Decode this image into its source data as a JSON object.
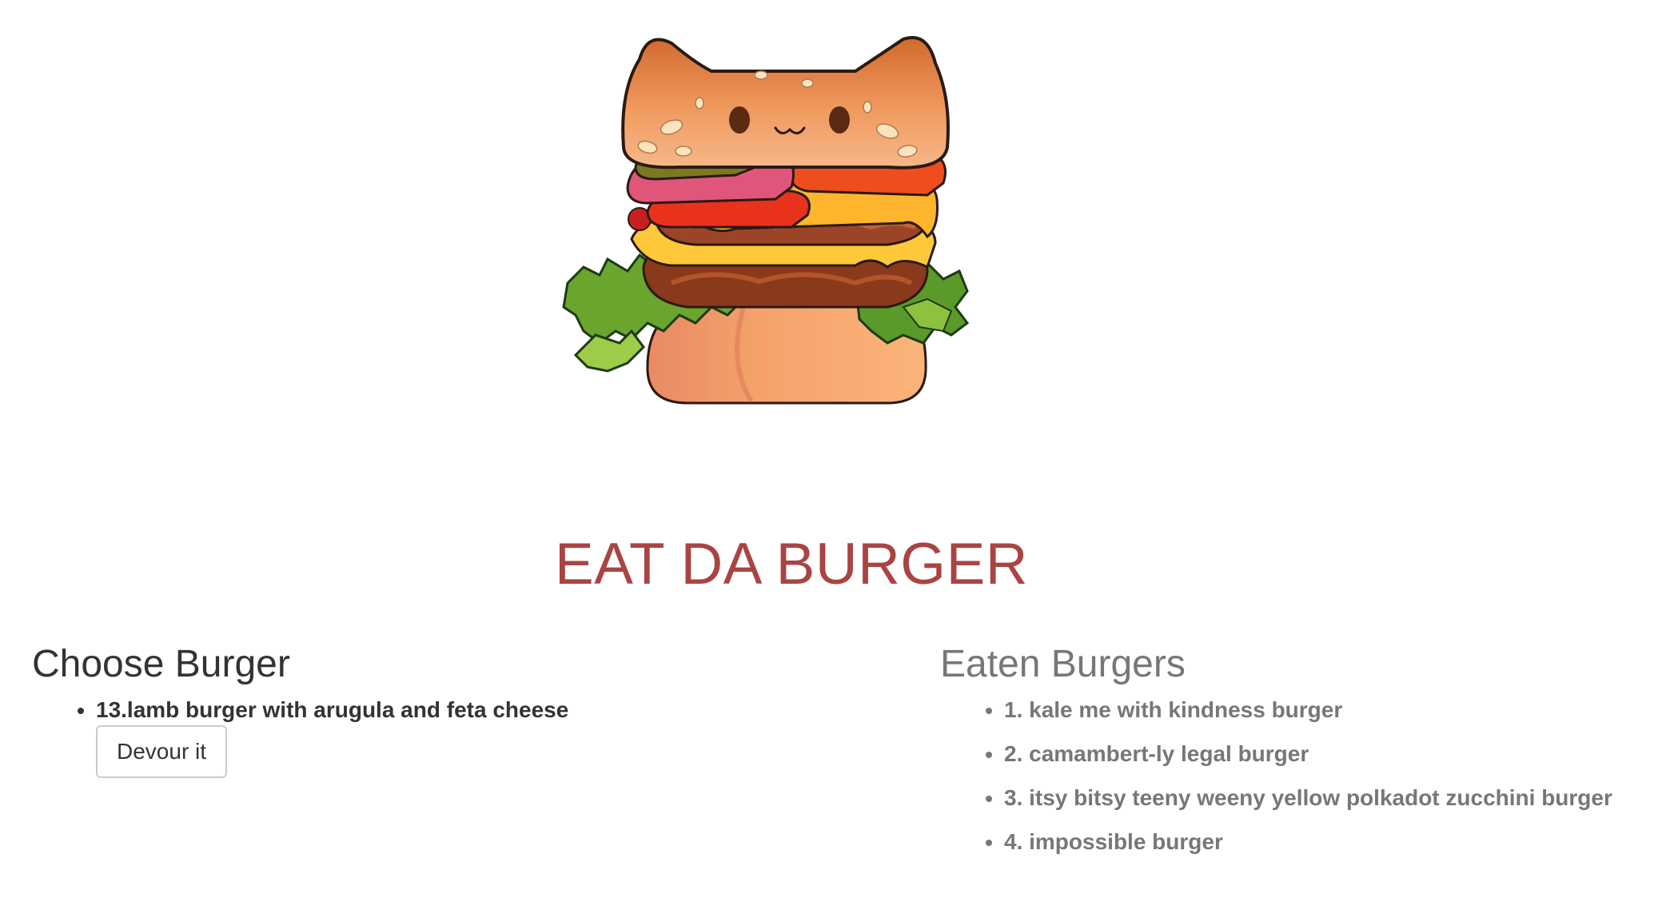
{
  "hero": {
    "image": "cat-burger-illustration"
  },
  "title": "EAT DA BURGER",
  "choose": {
    "heading": "Choose Burger",
    "items": [
      {
        "label": "13.lamb burger with arugula and feta cheese",
        "button": "Devour it"
      }
    ]
  },
  "eaten": {
    "heading": "Eaten Burgers",
    "items": [
      {
        "label": "1. kale me with kindness burger"
      },
      {
        "label": "2. camambert-ly legal burger"
      },
      {
        "label": "3. itsy bitsy teeny weeny yellow polkadot zucchini burger"
      },
      {
        "label": "4. impossible burger"
      }
    ]
  },
  "colors": {
    "title": "#a94442",
    "text": "#333333",
    "muted": "#777777"
  }
}
